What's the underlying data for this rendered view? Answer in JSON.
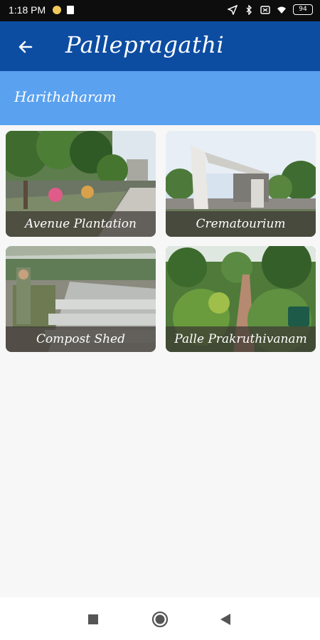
{
  "status_bar": {
    "time": "1:18 PM",
    "battery": "94",
    "icons": [
      "notification-dot-icon",
      "trash-icon",
      "location-arrow-icon",
      "bluetooth-icon",
      "sim-icon",
      "wifi-icon",
      "battery-icon"
    ]
  },
  "app_bar": {
    "back_icon": "arrow-left-icon",
    "title": "Pallepragathi"
  },
  "sub_header": {
    "title": "Harithaharam"
  },
  "tiles": [
    {
      "label": "Avenue Plantation"
    },
    {
      "label": "Crematourium"
    },
    {
      "label": "Compost Shed"
    },
    {
      "label": "Palle Prakruthivanam"
    }
  ],
  "nav_bar": {
    "icons": [
      "recents-square-icon",
      "home-circle-icon",
      "back-triangle-icon"
    ]
  },
  "colors": {
    "app_bar": "#0c4da2",
    "sub_header": "#5aa1ef",
    "background": "#f7f7f7"
  }
}
